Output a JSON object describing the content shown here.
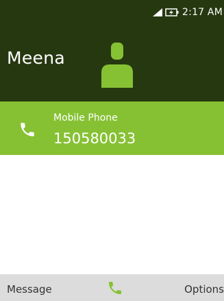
{
  "status_bar": {
    "time": "2:17 AM",
    "icons": [
      "signal-icon",
      "battery-charging-icon"
    ]
  },
  "contact": {
    "name": "Meena",
    "avatar_icon": "person-icon"
  },
  "phone_entry": {
    "type_label": "Mobile Phone",
    "number": "150580033",
    "icon": "phone-icon"
  },
  "softkeys": {
    "left_label": "Message",
    "center_icon": "phone-icon",
    "right_label": "Options"
  },
  "colors": {
    "header_bg": "#263810",
    "accent": "#86c134",
    "softkey_bg": "#dcdcdc"
  }
}
